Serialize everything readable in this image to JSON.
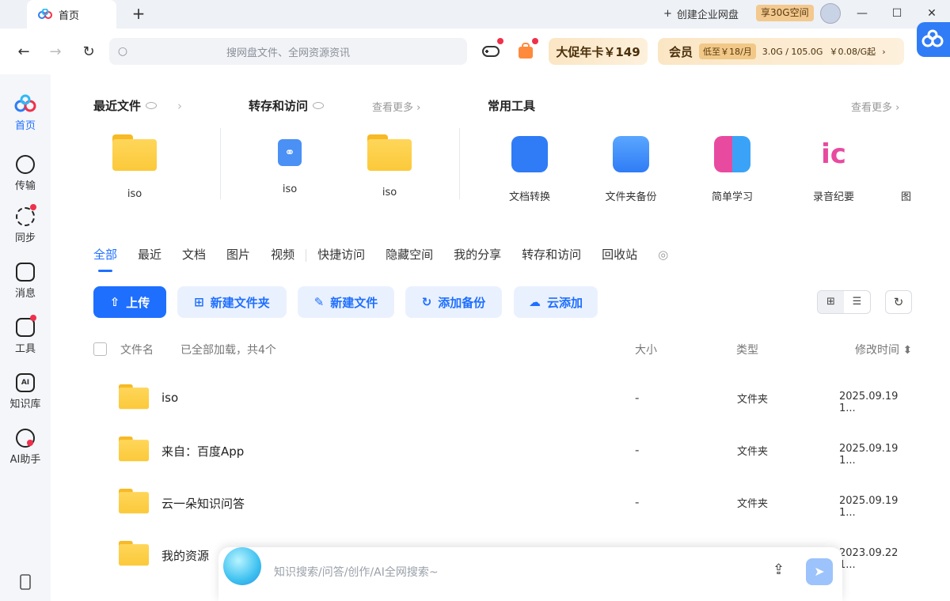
{
  "titlebar": {
    "tab_label": "首页",
    "new_tab": "+",
    "create_enterprise": "创建企业网盘",
    "free_space_badge": "享30G空间",
    "minimize": "—",
    "maximize": "☐",
    "close": "✕"
  },
  "toolbar": {
    "back": "←",
    "forward": "→",
    "reload": "↻",
    "search_placeholder": "搜网盘文件、全网资源资讯",
    "promo_label": "大促年卡￥149",
    "vip_label": "会员",
    "vip_price": "低至￥18/月",
    "quota": "3.0G / 105.0G",
    "quota_price": "￥0.08/G起",
    "quota_chevron": "›"
  },
  "sidebar": {
    "items": [
      {
        "label": "首页",
        "icon": "home-cloud-icon"
      },
      {
        "label": "传输",
        "icon": "transfer-icon"
      },
      {
        "label": "同步",
        "icon": "sync-icon"
      },
      {
        "label": "消息",
        "icon": "message-icon"
      },
      {
        "label": "工具",
        "icon": "tools-icon"
      },
      {
        "label": "知识库",
        "icon": "knowledge-icon"
      },
      {
        "label": "AI助手",
        "icon": "ai-assistant-icon"
      }
    ]
  },
  "recent": {
    "title": "最近文件",
    "items": [
      {
        "label": "iso"
      }
    ]
  },
  "saved": {
    "title": "转存和访问",
    "more": "查看更多",
    "items": [
      {
        "label": "iso"
      },
      {
        "label": "iso"
      }
    ]
  },
  "tools": {
    "title": "常用工具",
    "more": "查看更多",
    "items": [
      {
        "label": "文档转换",
        "icon": "pdf-convert-icon",
        "color": "#2f7cf6"
      },
      {
        "label": "文件夹备份",
        "icon": "folder-backup-icon",
        "color": "#2f7cf6"
      },
      {
        "label": "简单学习",
        "icon": "book-icon",
        "color": "#3aa3f7"
      },
      {
        "label": "录音纪要",
        "icon": "recording-notes-icon",
        "color": "#e84aa0"
      },
      {
        "label": "图"
      }
    ]
  },
  "categories": [
    "全部",
    "最近",
    "文档",
    "图片",
    "视频",
    "快捷访问",
    "隐藏空间",
    "我的分享",
    "转存和访问",
    "回收站"
  ],
  "actions": {
    "upload": "上传",
    "new_folder": "新建文件夹",
    "new_file": "新建文件",
    "add_backup": "添加备份",
    "cloud_add": "云添加"
  },
  "table": {
    "col_name": "文件名",
    "loaded_status": "已全部加载，共4个",
    "col_size": "大小",
    "col_type": "类型",
    "col_mtime": "修改时间",
    "rows": [
      {
        "name": "iso",
        "size": "-",
        "type": "文件夹",
        "mtime": "2025.09.19 1..."
      },
      {
        "name": "来自：百度App",
        "size": "-",
        "type": "文件夹",
        "mtime": "2025.09.19 1..."
      },
      {
        "name": "云一朵知识问答",
        "size": "-",
        "type": "文件夹",
        "mtime": "2025.09.19 1..."
      },
      {
        "name": "我的资源",
        "size": "",
        "type": "",
        "mtime": "2023.09.22 1..."
      }
    ]
  },
  "ai_bar": {
    "placeholder": "知识搜索/问答/创作/AI全网搜索~"
  },
  "colors": {
    "accent": "#1f6fff",
    "folder": "#fbc93a",
    "promo": "#fbe6c4"
  }
}
